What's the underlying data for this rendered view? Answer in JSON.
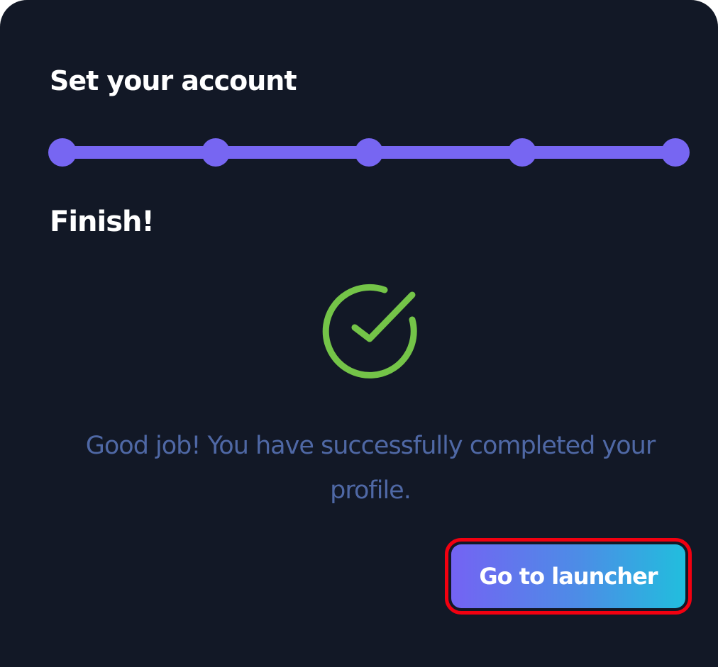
{
  "card": {
    "title": "Set your account"
  },
  "stepper": {
    "total_steps": 5,
    "completed_steps": 5,
    "accent_color": "#7766f2"
  },
  "step": {
    "title": "Finish!",
    "icon": "check-circle-icon",
    "icon_color": "#74c448",
    "message": "Good job! You have successfully completed your profile."
  },
  "actions": {
    "go_to_launcher_label": "Go to launcher"
  },
  "colors": {
    "background": "#121826",
    "message_text": "#4f68a5",
    "button_gradient_start": "#7463f3",
    "button_gradient_end": "#21bedd",
    "highlight_outline": "#f20010"
  }
}
